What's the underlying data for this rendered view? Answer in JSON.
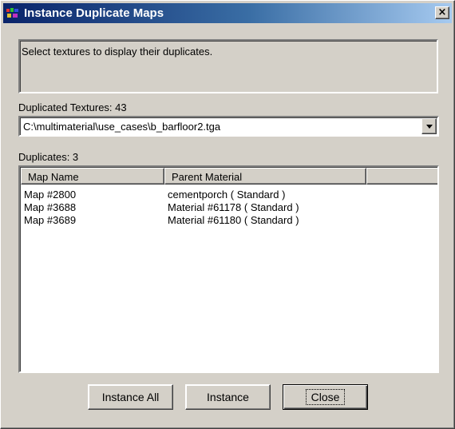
{
  "window": {
    "title": "Instance Duplicate Maps",
    "close_glyph": "×"
  },
  "status": {
    "message": "Select textures to display their duplicates."
  },
  "textures": {
    "label": "Duplicated Textures: 43",
    "selected": "C:\\multimaterial\\use_cases\\b_barfloor2.tga"
  },
  "duplicates": {
    "label": "Duplicates: 3",
    "columns": [
      "Map Name",
      "Parent Material",
      ""
    ],
    "rows": [
      {
        "map_name": "Map #2800",
        "parent_material": "cementporch  ( Standard )"
      },
      {
        "map_name": "Map #3688",
        "parent_material": "Material #61178  ( Standard )"
      },
      {
        "map_name": "Map #3689",
        "parent_material": "Material #61180  ( Standard )"
      }
    ]
  },
  "buttons": {
    "instance_all": "Instance All",
    "instance": "Instance",
    "close": "Close"
  },
  "icons": {
    "app_icon": "3dsmax-app-icon",
    "combo_arrow": "chevron-down-icon"
  },
  "colors": {
    "title_start": "#0a246a",
    "title_end": "#a6caf0",
    "face": "#d4d0c8"
  }
}
